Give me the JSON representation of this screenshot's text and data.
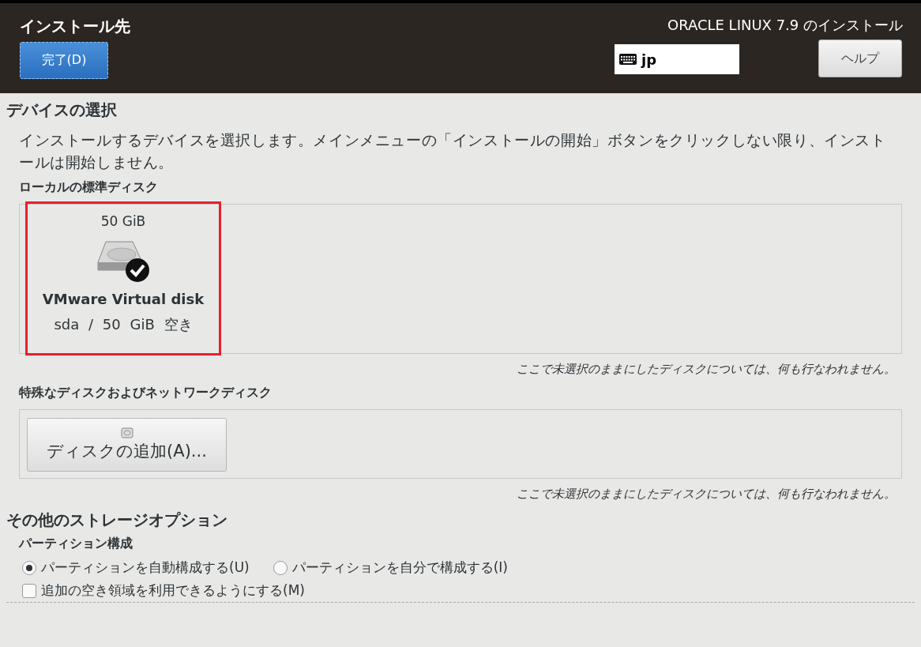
{
  "header": {
    "title": "インストール先",
    "done_button": "完了(D)",
    "product": "ORACLE LINUX 7.9 のインストール",
    "keyboard": "jp",
    "help_button": "ヘルプ"
  },
  "device_selection": {
    "heading": "デバイスの選択",
    "description": "インストールするデバイスを選択します。メインメニューの「インストールの開始」ボタンをクリックしない限り、インストールは開始しません。",
    "local": {
      "label": "ローカルの標準ディスク",
      "disks": [
        {
          "size": "50 GiB",
          "name": "VMware Virtual disk",
          "device": "sda",
          "separator": "/",
          "free": "50 GiB 空き",
          "selected": true,
          "highlighted": true
        }
      ],
      "note": "ここで未選択のままにしたディスクについては、何も行なわれません。"
    },
    "special": {
      "label": "特殊なディスクおよびネットワークディスク",
      "add_button": "ディスクの追加(A)...",
      "note": "ここで未選択のままにしたディスクについては、何も行なわれません。"
    }
  },
  "other_options": {
    "heading": "その他のストレージオプション",
    "partitioning": {
      "label": "パーティション構成",
      "options": [
        {
          "label": "パーティションを自動構成する(U)",
          "selected": true
        },
        {
          "label": "パーティションを自分で構成する(I)",
          "selected": false
        }
      ]
    },
    "extra_space": {
      "label": "追加の空き領域を利用できるようにする(M)",
      "checked": false
    }
  }
}
